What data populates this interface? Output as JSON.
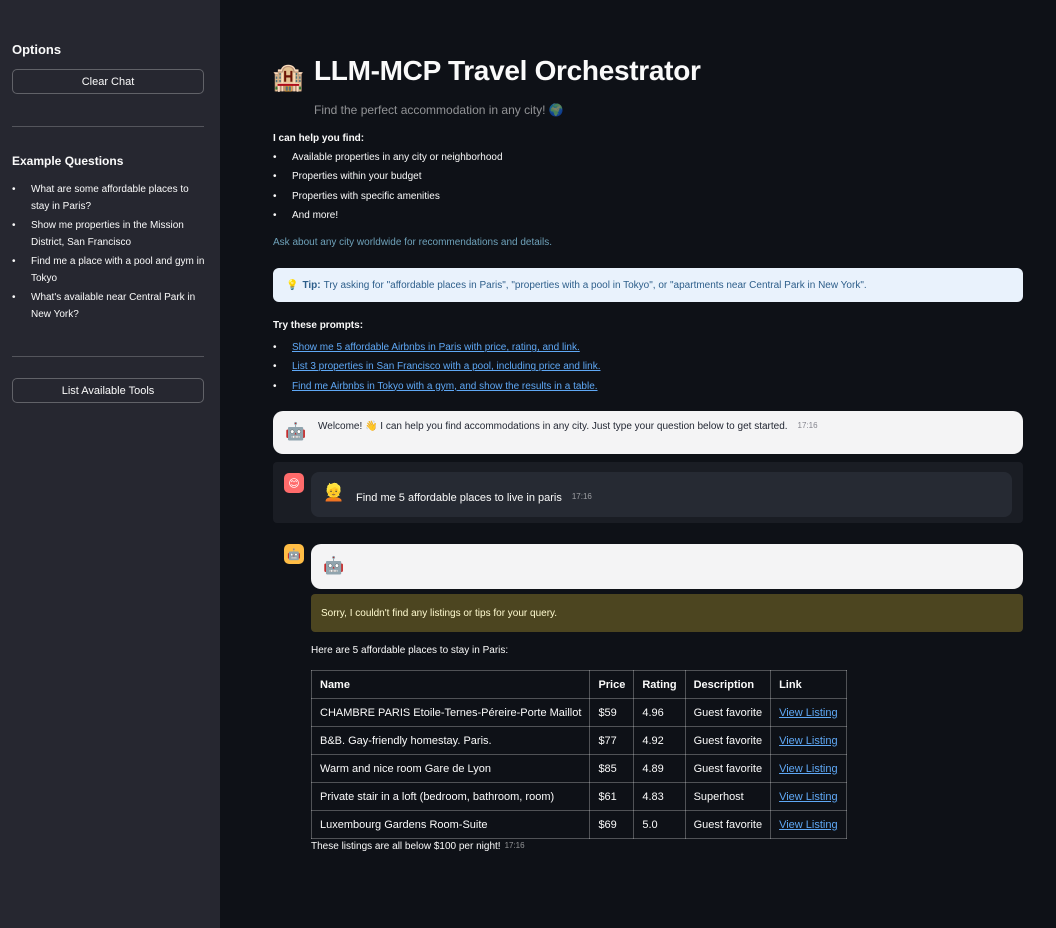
{
  "sidebar": {
    "title": "Options",
    "clear_chat": "Clear Chat",
    "examples_title": "Example Questions",
    "examples": [
      "What are some affordable places to stay in Paris?",
      "Show me properties in the Mission District, San Francisco",
      "Find me a place with a pool and gym in Tokyo",
      "What's available near Central Park in New York?"
    ],
    "list_tools": "List Available Tools"
  },
  "header": {
    "emoji": "🏨",
    "title": "LLM-MCP Travel Orchestrator",
    "subtitle": "Find the perfect accommodation in any city! 🌍"
  },
  "help": {
    "lead": "I can help you find:",
    "items": [
      "Available properties in any city or neighborhood",
      "Properties within your budget",
      "Properties with specific amenities",
      "And more!"
    ],
    "caption": "Ask about any city worldwide for recommendations and details."
  },
  "tip": {
    "icon": "💡",
    "label": "Tip:",
    "text": "Try asking for \"affordable places in Paris\", \"properties with a pool in Tokyo\", or \"apartments near Central Park in New York\"."
  },
  "prompts": {
    "lead": "Try these prompts:",
    "items": [
      "Show me 5 affordable Airbnbs in Paris with price, rating, and link.",
      "List 3 properties in San Francisco with a pool, including price and link.",
      "Find me Airbnbs in Tokyo with a gym, and show the results in a table."
    ]
  },
  "chat": {
    "welcome": {
      "avatar": "🤖",
      "text": "Welcome! 👋 I can help you find accommodations in any city. Just type your question below to get started.",
      "time": "17:16"
    },
    "user": {
      "avatar": "😊",
      "face": "👱",
      "text": "Find me 5 affordable places to live in paris",
      "time": "17:16"
    },
    "assistant": {
      "avatar": "🤖",
      "warning": "Sorry, I couldn't find any listings or tips for your query.",
      "intro": "Here are 5 affordable places to stay in Paris:",
      "table": {
        "headers": [
          "Name",
          "Price",
          "Rating",
          "Description",
          "Link"
        ],
        "rows": [
          [
            "CHAMBRE PARIS Etoile-Ternes-Péreire-Porte Maillot",
            "$59",
            "4.96",
            "Guest favorite",
            "View Listing"
          ],
          [
            "B&B. Gay-friendly homestay. Paris.",
            "$77",
            "4.92",
            "Guest favorite",
            "View Listing"
          ],
          [
            "Warm and nice room Gare de Lyon",
            "$85",
            "4.89",
            "Guest favorite",
            "View Listing"
          ],
          [
            "Private stair in a loft (bedroom, bathroom, room)",
            "$61",
            "4.83",
            "Superhost",
            "View Listing"
          ],
          [
            "Luxembourg Gardens Room-Suite",
            "$69",
            "5.0",
            "Guest favorite",
            "View Listing"
          ]
        ]
      },
      "closing": "These listings are all below $100 per night!",
      "time": "17:16"
    }
  }
}
